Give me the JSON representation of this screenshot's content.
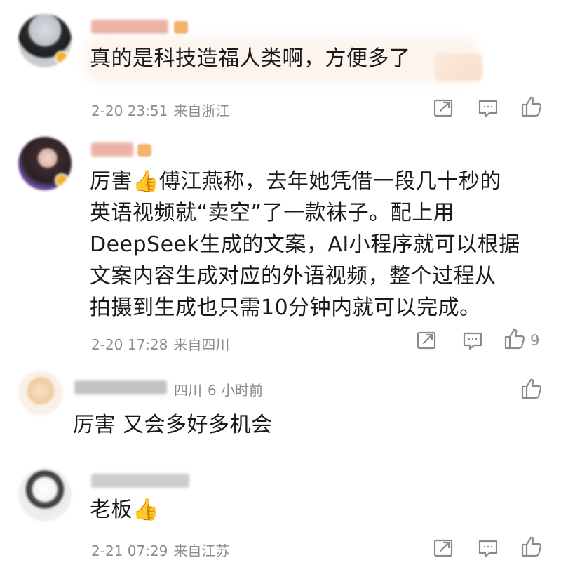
{
  "comments": [
    {
      "text": "真的是科技造福人类啊，方便多了",
      "date": "2-20 23:51",
      "location": "来自浙江",
      "likes": ""
    },
    {
      "lines": [
        "厉害👍傅江燕称，去年她凭借一段几十秒的",
        "英语视频就“卖空”了一款袜子。配上用",
        "DeepSeek生成的文案，AI小程序就可以根据",
        "文案内容生成对应的外语视频，整个过程从",
        "拍摄到生成也只需10分钟内就可以完成。"
      ],
      "date": "2-20 17:28",
      "location": "来自四川",
      "likes": "9"
    },
    {
      "location": "四川",
      "time": "6 小时前",
      "text": "厉害 又会多好多机会"
    },
    {
      "text": "老板👍",
      "date": "2-21 07:29",
      "location": "来自江苏",
      "likes": ""
    }
  ],
  "icons": {
    "share": "share-icon",
    "comment": "comment-icon",
    "like": "thumbs-up-icon"
  },
  "colors": {
    "meta_text": "#8c8c8c",
    "body_text": "#1a1a1a",
    "vip_badge": "#f0a24a"
  }
}
